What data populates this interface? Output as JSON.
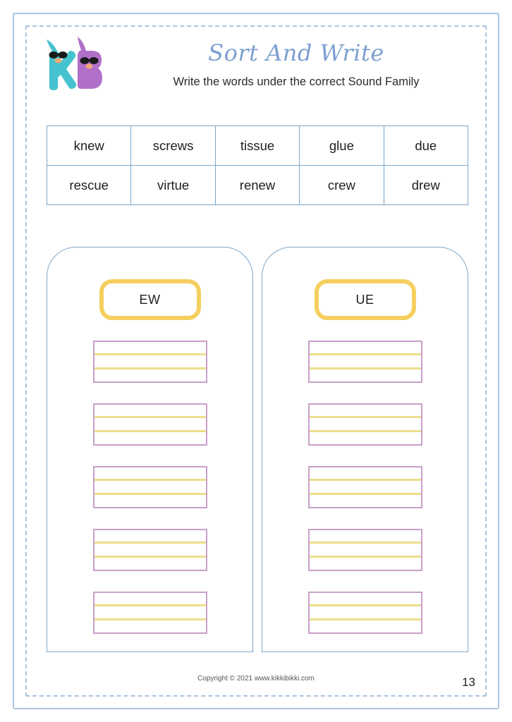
{
  "header": {
    "title": "Sort And Write",
    "subtitle": "Write the words under the correct Sound Family",
    "logo_alt": "kikkibikki-kb-logo"
  },
  "word_bank": {
    "rows": [
      [
        "knew",
        "screws",
        "tissue",
        "glue",
        "due"
      ],
      [
        "rescue",
        "virtue",
        "renew",
        "crew",
        "drew"
      ]
    ]
  },
  "sort_columns": [
    {
      "heading": "EW",
      "slots": 5
    },
    {
      "heading": "UE",
      "slots": 5
    }
  ],
  "footer": {
    "copyright": "Copyright © 2021 www.kikkibikki.com",
    "page_number": "13"
  },
  "colors": {
    "frame_blue": "#a8c4e0",
    "table_blue": "#7da7c9",
    "title_blue": "#7d9fd1",
    "badge_yellow": "#f5cf5f",
    "box_purple": "#c9a0c9",
    "guide_yellow": "#ecdf8a",
    "logo_teal": "#45c3cf",
    "logo_purple": "#b070c8"
  }
}
